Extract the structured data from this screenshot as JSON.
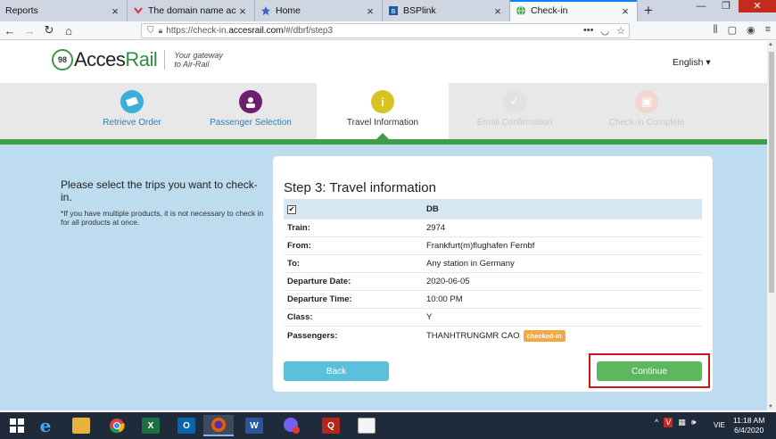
{
  "browser": {
    "tabs": [
      {
        "title": "Reports",
        "active": false
      },
      {
        "title": "The domain name accessrail.co",
        "active": false
      },
      {
        "title": "Home",
        "active": false
      },
      {
        "title": "BSPlink",
        "active": false
      },
      {
        "title": "Check-in",
        "active": true
      }
    ],
    "new_tab": "+",
    "url_scheme": "https://check-in.",
    "url_host": "accesrail.com",
    "url_path": "/#/dbrf/step3"
  },
  "header": {
    "logo_mark": "98",
    "logo_prefix": "Acces",
    "logo_suffix": "Rail",
    "tagline_line1": "Your gateway",
    "tagline_line2": "to Air-Rail",
    "language": "English ▾"
  },
  "steps": [
    {
      "label": "Retrieve Order",
      "state": "done",
      "color": "#3bafd8"
    },
    {
      "label": "Passenger Selection",
      "state": "done",
      "color": "#6b1f6e"
    },
    {
      "label": "Travel Information",
      "state": "current",
      "color": "#d9c323"
    },
    {
      "label": "Email Confirmation",
      "state": "future",
      "color": "#e2e2e2"
    },
    {
      "label": "Check-in Complete",
      "state": "future",
      "color": "#f3d6d2"
    }
  ],
  "intro": {
    "heading": "Please select the trips you want to check-in.",
    "note": "*If you have multiple products, it is not necessary to check in for all products at once."
  },
  "card": {
    "title": "Step 3: Travel information",
    "header_value": "DB",
    "rows": [
      {
        "label": "Train:",
        "value": "2974"
      },
      {
        "label": "From:",
        "value": "Frankfurt(m)flughafen Fernbf"
      },
      {
        "label": "To:",
        "value": "Any station in Germany"
      },
      {
        "label": "Departure Date:",
        "value": "2020-06-05"
      },
      {
        "label": "Departure Time:",
        "value": "10:00 PM"
      },
      {
        "label": "Class:",
        "value": "Y"
      },
      {
        "label": "Passengers:",
        "value": "THANHTRUNGMR CAO"
      }
    ],
    "passenger_badge": "checked-in",
    "back_label": "Back",
    "continue_label": "Continue"
  },
  "taskbar": {
    "tray_lang": "VIE",
    "time": "11:18 AM",
    "date": "6/4/2020"
  }
}
